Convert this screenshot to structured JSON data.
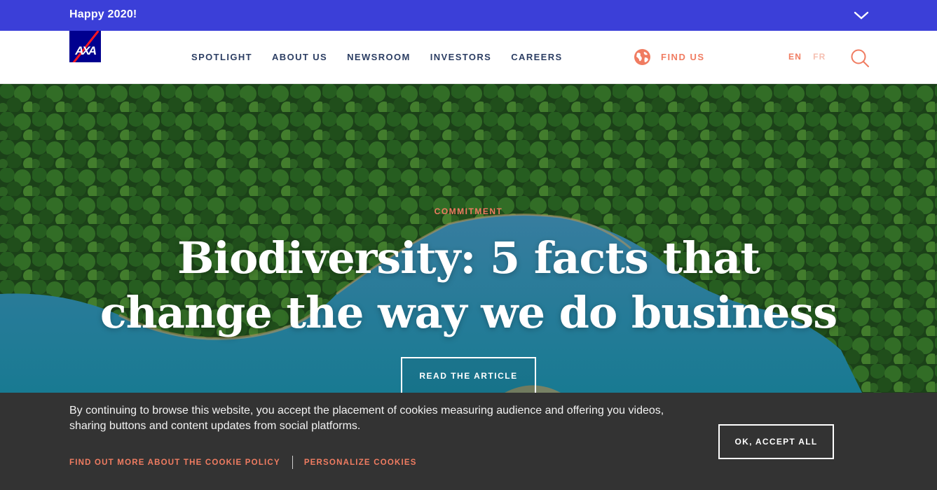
{
  "banner": {
    "text": "Happy 2020!",
    "toggle_icon": "chevron-down-icon"
  },
  "header": {
    "logo_text": "AXA",
    "nav": [
      "SPOTLIGHT",
      "ABOUT US",
      "NEWSROOM",
      "INVESTORS",
      "CAREERS"
    ],
    "find_us": "FIND US",
    "lang_en": "EN",
    "lang_fr": "FR"
  },
  "hero": {
    "kicker": "COMMITMENT",
    "headline_line1": "Biodiversity: 5 facts that",
    "headline_line2": "change the way we do business",
    "cta": "READ THE ARTICLE"
  },
  "cookie": {
    "message": "By continuing to browse this website, you accept the placement of cookies measuring audience and offering you videos, sharing buttons and content updates from social platforms.",
    "policy_link": "FIND OUT MORE ABOUT THE COOKIE POLICY",
    "personalize_link": "PERSONALIZE COOKIES",
    "accept": "OK, ACCEPT ALL"
  },
  "colors": {
    "banner": "#3b3fd8",
    "brand_blue": "#00008f",
    "brand_red": "#ff1721",
    "nav_text": "#2c3e63",
    "accent": "#f07c61",
    "cookie_bg": "#333333"
  }
}
